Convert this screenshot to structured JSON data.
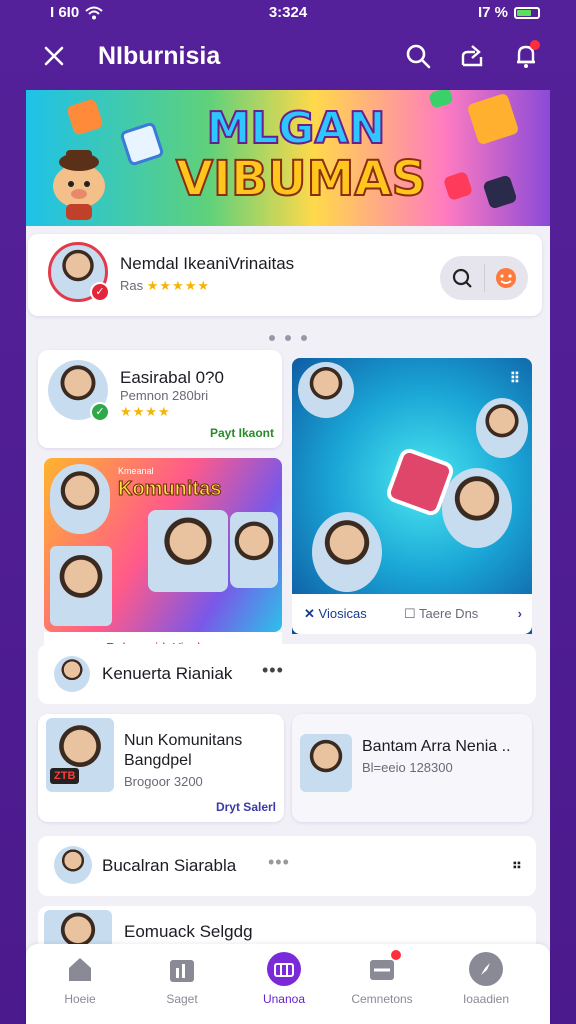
{
  "status_bar": {
    "left": "I 6I0",
    "time": "3:324",
    "right": "I7 %"
  },
  "topbar": {
    "title": "NIburnisia"
  },
  "banner": {
    "line1": "MLGAN",
    "line2": "VIBUMAS"
  },
  "featured": {
    "name": "Nemdal IkeaniVrinaitas",
    "sub": "Ras",
    "stars": "★★★★★"
  },
  "card_left": {
    "name": "Easirabal 0?0",
    "sub": "Pemnon 280bri",
    "stars": "★★★★",
    "link": "Payt Ikaont"
  },
  "komunitas": {
    "small": "Kmeanal",
    "title": "Komunitas",
    "footer": "RekanuriduYicel"
  },
  "big_card": {
    "action1": "Viosicas",
    "action2": "Taere Dns"
  },
  "row1": {
    "name": "Kenuerta Rianiak"
  },
  "post_left": {
    "title1": "Nun Komunitans",
    "title2": "Bangdpel",
    "sub": "Brogoor 3200",
    "link": "Dryt Salerl",
    "tag": "ZTB"
  },
  "post_right": {
    "title": "Bantam Arra Nenia ..",
    "sub": "Bl=eeio 128300"
  },
  "row2": {
    "name": "Bucalran Siarabla"
  },
  "row3": {
    "name": "Eomuack Selgdg"
  },
  "bottom_nav": [
    {
      "label": "Hoeie",
      "icon": "home-icon"
    },
    {
      "label": "Saget",
      "icon": "chart-icon"
    },
    {
      "label": "Unanoa",
      "icon": "community-icon"
    },
    {
      "label": "Cemnetons",
      "icon": "inbox-icon"
    },
    {
      "label": "Ioaadien",
      "icon": "compass-icon"
    }
  ],
  "colors": {
    "accent": "#7a2ad8",
    "frame": "#55219a",
    "link_green": "#2a8a2a"
  }
}
